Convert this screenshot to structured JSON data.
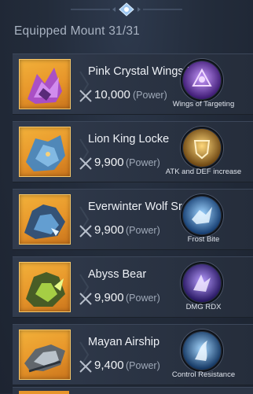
{
  "header": {
    "title": "Equipped Mount 31/31"
  },
  "mounts": [
    {
      "name": "Pink Crystal Wings Beast",
      "power": "10,000",
      "power_label": "(Power)",
      "skill": "Wings of Targeting",
      "skill_icon": "wings-skill-icon",
      "skill_color": "#7a3ad6",
      "thumb_color": "#9a3cc8"
    },
    {
      "name": "Lion King Locke",
      "power": "9,900",
      "power_label": "(Power)",
      "skill": "ATK and DEF increase",
      "skill_icon": "shield-skill-icon",
      "skill_color": "#d59a2a",
      "thumb_color": "#3f7fbf"
    },
    {
      "name": "Everwinter Wolf Sr",
      "power": "9,900",
      "power_label": "(Power)",
      "skill": "Frost Bite",
      "skill_icon": "frost-skill-icon",
      "skill_color": "#3c7fd8",
      "thumb_color": "#3a6aa8"
    },
    {
      "name": "Abyss Bear",
      "power": "9,900",
      "power_label": "(Power)",
      "skill": "DMG RDX",
      "skill_icon": "dmg-rdx-skill-icon",
      "skill_color": "#6b46d0",
      "thumb_color": "#4a7a2e"
    },
    {
      "name": "Mayan Airship",
      "power": "9,400",
      "power_label": "(Power)",
      "skill": "Control Resistance",
      "skill_icon": "control-resistance-skill-icon",
      "skill_color": "#2f7bd0",
      "thumb_color": "#6e7a86"
    }
  ]
}
